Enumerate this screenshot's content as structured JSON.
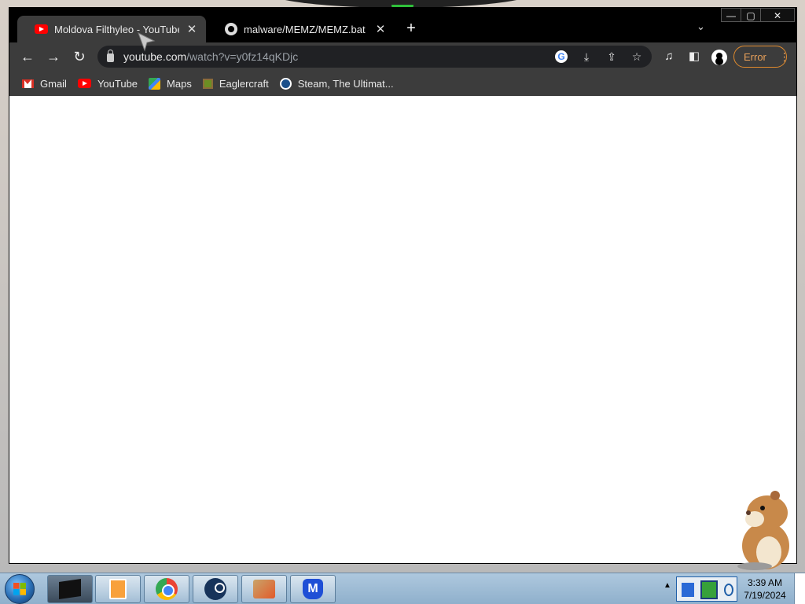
{
  "browser": {
    "tabs": [
      {
        "title": "Moldova Filthyleo - YouTube",
        "icon": "youtube-icon",
        "active": true
      },
      {
        "title": "malware/MEMZ/MEMZ.bat at ma",
        "icon": "github-icon",
        "active": false
      }
    ],
    "new_tab": "+",
    "tab_search": "⌄",
    "window_controls": {
      "minimize": "—",
      "maximize": "▢",
      "close": "✕"
    },
    "nav": {
      "back": "←",
      "forward": "→",
      "reload": "↻"
    },
    "address": {
      "host": "youtube.com",
      "path": "/watch?v=y0fz14qKDjc"
    },
    "profile_status": "Error",
    "menu": "⋮",
    "bookmarks": [
      {
        "label": "Gmail",
        "icon": "gmail-icon"
      },
      {
        "label": "YouTube",
        "icon": "youtube-icon"
      },
      {
        "label": "Maps",
        "icon": "maps-icon"
      },
      {
        "label": "Eaglercraft",
        "icon": "eaglercraft-icon"
      },
      {
        "label": "Steam, The Ultimat...",
        "icon": "steam-icon"
      }
    ]
  },
  "taskbar": {
    "apps": [
      "terminal-app-icon",
      "media-app-icon",
      "chrome-icon",
      "steam-icon",
      "game-app-icon",
      "malwarebytes-icon"
    ],
    "clock": {
      "time": "3:39 AM",
      "date": "7/19/2024"
    }
  },
  "colors": {
    "tab_strip": "#000000",
    "toolbar": "#3c3c3c",
    "error_accent": "#e08a2d",
    "taskbar": "#aec8de"
  }
}
